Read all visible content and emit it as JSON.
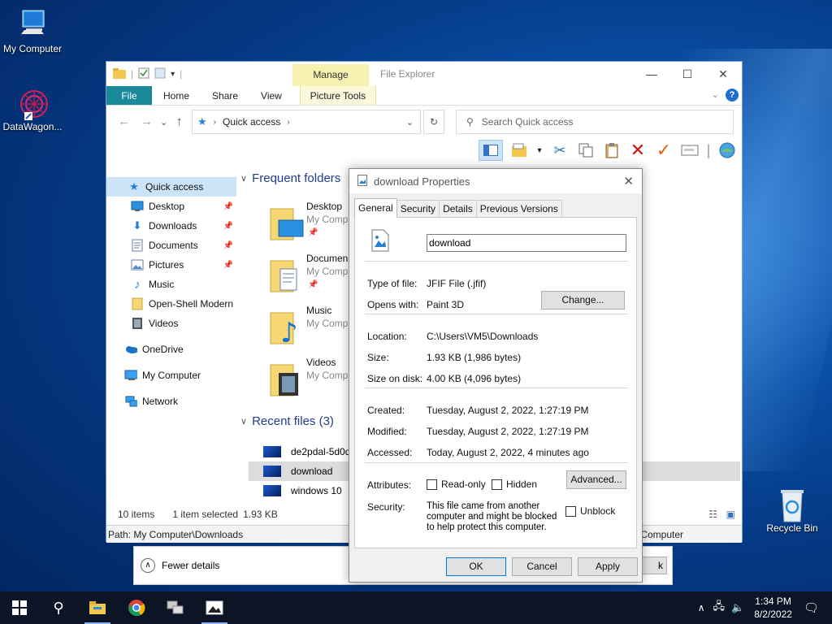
{
  "desktop": {
    "icons": [
      {
        "label": "My Computer",
        "icon": "computer-icon"
      },
      {
        "label": "DataWagon...",
        "icon": "datawagon-icon"
      },
      {
        "label": "Recycle Bin",
        "icon": "recycle-bin-icon"
      }
    ]
  },
  "explorer": {
    "window_title": "File Explorer",
    "context_tab": "Manage",
    "ribbon_tabs": [
      "File",
      "Home",
      "Share",
      "View",
      "Picture Tools"
    ],
    "address": "Quick access",
    "search_placeholder": "Search Quick access",
    "sidebar": [
      {
        "label": "Quick access",
        "icon": "star-icon",
        "selected": true
      },
      {
        "label": "Desktop",
        "icon": "desktop-icon",
        "pinned": true
      },
      {
        "label": "Downloads",
        "icon": "download-icon",
        "pinned": true
      },
      {
        "label": "Documents",
        "icon": "documents-icon",
        "pinned": true
      },
      {
        "label": "Pictures",
        "icon": "pictures-icon",
        "pinned": true
      },
      {
        "label": "Music",
        "icon": "music-icon"
      },
      {
        "label": "Open-Shell Modern",
        "icon": "folder-icon"
      },
      {
        "label": "Videos",
        "icon": "videos-icon"
      },
      {
        "label": "OneDrive",
        "icon": "cloud-icon"
      },
      {
        "label": "My Computer",
        "icon": "computer-icon"
      },
      {
        "label": "Network",
        "icon": "network-icon"
      }
    ],
    "frequent_header": "Frequent folders",
    "frequent": [
      {
        "name": "Desktop",
        "sub": "My Comp"
      },
      {
        "name": "Documen",
        "sub": "My Comp"
      },
      {
        "name": "Music",
        "sub": "My Comp"
      },
      {
        "name": "Videos",
        "sub": "My Comp"
      }
    ],
    "recent_header": "Recent files (3)",
    "recent": [
      {
        "name": "de2pdal-5d0d",
        "selected": false
      },
      {
        "name": "download",
        "selected": true
      },
      {
        "name": "windows 10",
        "selected": false
      }
    ],
    "status": {
      "items": "10 items",
      "selected": "1 item selected",
      "size": "1.93 KB"
    },
    "path": "Path: My Computer\\Downloads",
    "path_right": "Computer"
  },
  "fewer_details": "Fewer details",
  "dialog": {
    "title": "download Properties",
    "tabs": [
      "General",
      "Security",
      "Details",
      "Previous Versions"
    ],
    "file_name": "download",
    "type_label": "Type of file:",
    "type_value": "JFIF File (.jfif)",
    "opens_label": "Opens with:",
    "opens_value": "Paint 3D",
    "change_btn": "Change...",
    "location_label": "Location:",
    "location_value": "C:\\Users\\VM5\\Downloads",
    "size_label": "Size:",
    "size_value": "1.93 KB (1,986 bytes)",
    "disk_label": "Size on disk:",
    "disk_value": "4.00 KB (4,096 bytes)",
    "created_label": "Created:",
    "created_value": "Tuesday, August 2, 2022, 1:27:19 PM",
    "modified_label": "Modified:",
    "modified_value": "Tuesday, August 2, 2022, 1:27:19 PM",
    "accessed_label": "Accessed:",
    "accessed_value": "Today, August 2, 2022, 4 minutes ago",
    "attributes_label": "Attributes:",
    "readonly": "Read-only",
    "hidden": "Hidden",
    "advanced_btn": "Advanced...",
    "security_label": "Security:",
    "security_text": "This file came from another computer and might be blocked to help protect this computer.",
    "unblock": "Unblock",
    "ok": "OK",
    "cancel": "Cancel",
    "apply": "Apply"
  },
  "taskbar": {
    "time": "1:34 PM",
    "date": "8/2/2022"
  }
}
